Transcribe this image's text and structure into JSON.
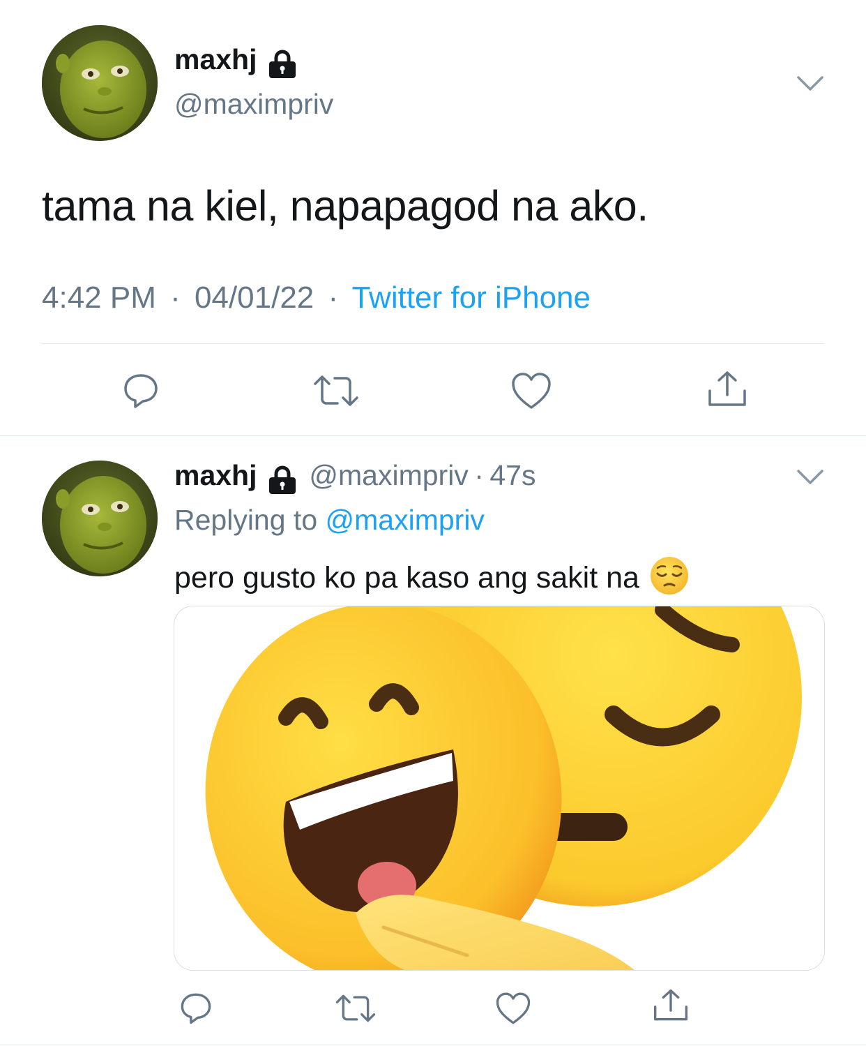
{
  "main_tweet": {
    "display_name": "maxhj",
    "handle": "@maximpriv",
    "text": "tama na kiel, napapagod na ako.",
    "time": "4:42 PM",
    "date": "04/01/22",
    "separator": "·",
    "source": "Twitter for iPhone",
    "actions": [
      "reply-icon",
      "retweet-icon",
      "like-icon",
      "share-icon"
    ]
  },
  "reply_tweet": {
    "display_name": "maxhj",
    "handle": "@maximpriv",
    "time_ago": "47s",
    "separator": "·",
    "replying_prefix": "Replying to",
    "replying_handle": "@maximpriv",
    "text": "pero gusto ko pa kaso ang sakit na",
    "emoji": "pensive-face-emoji",
    "media": "smiling-mask-over-sad-face-emoji",
    "actions": [
      "reply-icon",
      "retweet-icon",
      "like-icon",
      "share-icon"
    ]
  },
  "colors": {
    "accent": "#1da1f2",
    "secondary_text": "#657786",
    "primary_text": "#14171a",
    "divider": "#e1e8ed"
  }
}
